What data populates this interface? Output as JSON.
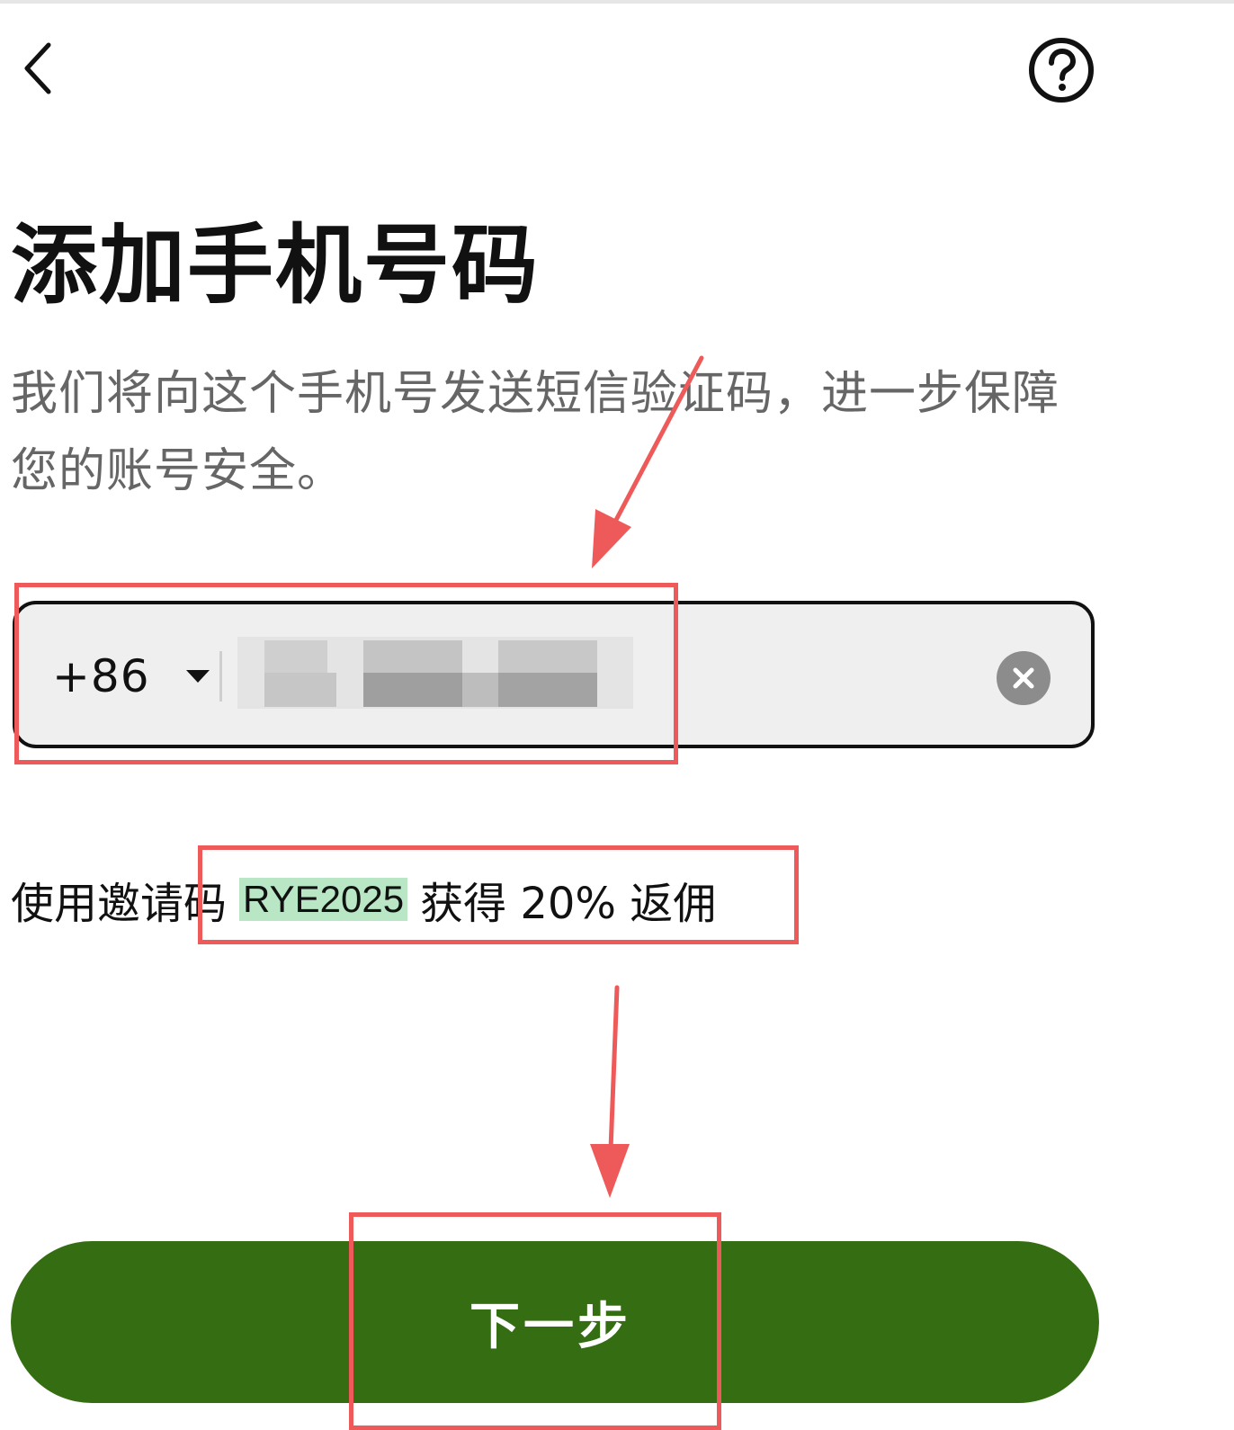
{
  "header": {
    "back_icon": "chevron-left-icon",
    "help_icon": "question-circle-icon"
  },
  "title": "添加手机号码",
  "subtitle": "我们将向这个手机号发送短信验证码，进一步保障您的账号安全。",
  "phone_field": {
    "country_code": "+86",
    "dropdown_icon": "caret-down-icon",
    "clear_icon": "clear-circle-icon"
  },
  "invite": {
    "prefix": "使用邀请码",
    "code": "RYE2025",
    "suffix": "获得 20% 返佣"
  },
  "next_button": {
    "label": "下一步"
  },
  "colors": {
    "accent": "#356d12",
    "annotation": "#ee5a5a",
    "field_background": "#efefef",
    "code_highlight": "#b9e6c4"
  }
}
